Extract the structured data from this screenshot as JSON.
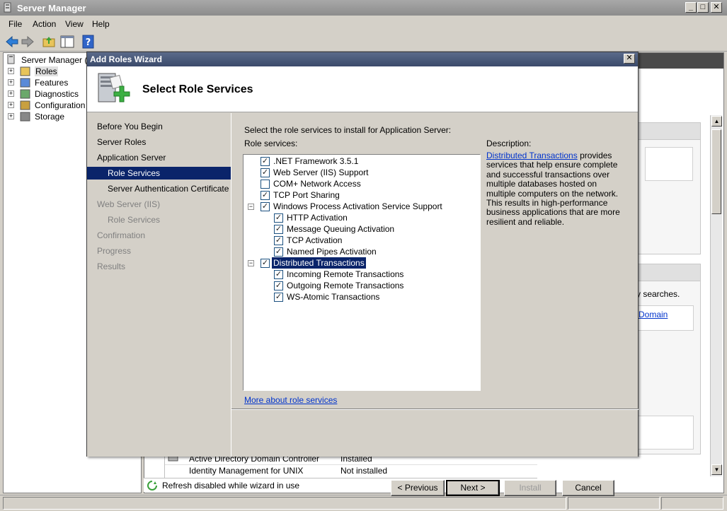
{
  "window": {
    "title": "Server Manager"
  },
  "menu": [
    "File",
    "Action",
    "View",
    "Help"
  ],
  "tree": {
    "root": "Server Manager (SE",
    "items": [
      {
        "label": "Roles",
        "icon": "roles-icon"
      },
      {
        "label": "Features",
        "icon": "features-icon"
      },
      {
        "label": "Diagnostics",
        "icon": "diagnostics-icon"
      },
      {
        "label": "Configuration",
        "icon": "configuration-icon"
      },
      {
        "label": "Storage",
        "icon": "storage-icon"
      }
    ]
  },
  "background": {
    "searches_text": "y searches.",
    "domain_link": "Domain",
    "table_rows": [
      {
        "name": "Active Directory Domain Controller",
        "status": "Installed"
      },
      {
        "name": "Identity Management for UNIX",
        "status": "Not installed"
      }
    ],
    "status_text": "Refresh disabled while wizard in use"
  },
  "wizard": {
    "title": "Add Roles Wizard",
    "heading": "Select Role Services",
    "nav": [
      {
        "label": "Before You Begin",
        "indent": 0,
        "state": "normal"
      },
      {
        "label": "Server Roles",
        "indent": 0,
        "state": "normal"
      },
      {
        "label": "Application Server",
        "indent": 0,
        "state": "normal"
      },
      {
        "label": "Role Services",
        "indent": 1,
        "state": "selected"
      },
      {
        "label": "Server Authentication Certificate",
        "indent": 1,
        "state": "normal"
      },
      {
        "label": "Web Server (IIS)",
        "indent": 0,
        "state": "disabled"
      },
      {
        "label": "Role Services",
        "indent": 1,
        "state": "disabled"
      },
      {
        "label": "Confirmation",
        "indent": 0,
        "state": "disabled"
      },
      {
        "label": "Progress",
        "indent": 0,
        "state": "disabled"
      },
      {
        "label": "Results",
        "indent": 0,
        "state": "disabled"
      }
    ],
    "instruction": "Select the role services to install for Application Server:",
    "role_services_label": "Role services:",
    "role_services": [
      {
        "label": ".NET Framework 3.5.1",
        "checked": true,
        "level": 0,
        "expander": ""
      },
      {
        "label": "Web Server (IIS) Support",
        "checked": true,
        "level": 0,
        "expander": ""
      },
      {
        "label": "COM+ Network Access",
        "checked": false,
        "level": 0,
        "expander": ""
      },
      {
        "label": "TCP Port Sharing",
        "checked": true,
        "level": 0,
        "expander": ""
      },
      {
        "label": "Windows Process Activation Service Support",
        "checked": true,
        "level": 0,
        "expander": "−"
      },
      {
        "label": "HTTP Activation",
        "checked": true,
        "level": 1,
        "expander": ""
      },
      {
        "label": "Message Queuing Activation",
        "checked": true,
        "level": 1,
        "expander": ""
      },
      {
        "label": "TCP Activation",
        "checked": true,
        "level": 1,
        "expander": ""
      },
      {
        "label": "Named Pipes Activation",
        "checked": true,
        "level": 1,
        "expander": ""
      },
      {
        "label": "Distributed Transactions",
        "checked": true,
        "level": 0,
        "expander": "−",
        "selected": true
      },
      {
        "label": "Incoming Remote Transactions",
        "checked": true,
        "level": 1,
        "expander": ""
      },
      {
        "label": "Outgoing Remote Transactions",
        "checked": true,
        "level": 1,
        "expander": ""
      },
      {
        "label": "WS-Atomic Transactions",
        "checked": true,
        "level": 1,
        "expander": ""
      }
    ],
    "description_label": "Description:",
    "description_link": "Distributed Transactions",
    "description_text": " provides services that help ensure complete and successful transactions over multiple databases hosted on multiple computers on the network. This results in high-performance business applications that are more resilient and reliable.",
    "more_link": "More about role services",
    "buttons": {
      "previous": "< Previous",
      "next": "Next >",
      "install": "Install",
      "cancel": "Cancel"
    }
  },
  "colors": {
    "selection": "#0a246a",
    "link": "#0033cc",
    "dialog_title": "#3b4a6b"
  }
}
